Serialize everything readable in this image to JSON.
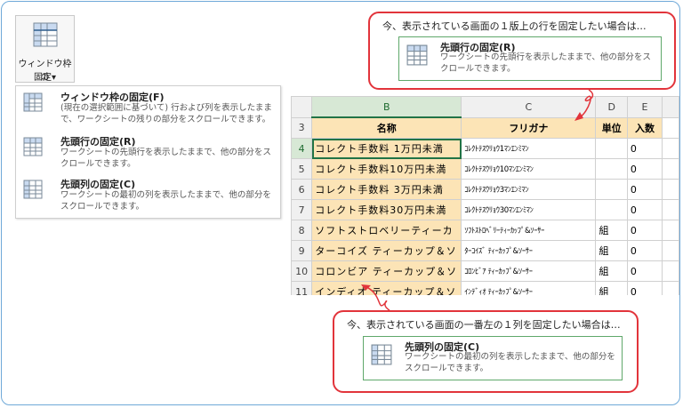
{
  "ribbon": {
    "button_label_line1": "ウィンドウ枠の",
    "button_label_line2": "固定▾",
    "icon": "freeze-panes-icon"
  },
  "menu": {
    "items": [
      {
        "title": "ウィンドウ枠の固定(F)",
        "desc": "(現在の選択範囲に基づいて) 行および列を表示したままで、ワークシートの残りの部分をスクロールできます。",
        "icon": "freeze-panes-icon"
      },
      {
        "title": "先頭行の固定(R)",
        "desc": "ワークシートの先頭行を表示したままで、他の部分をスクロールできます。",
        "icon": "freeze-top-row-icon"
      },
      {
        "title": "先頭列の固定(C)",
        "desc": "ワークシートの最初の列を表示したままで、他の部分をスクロールできます。",
        "icon": "freeze-first-column-icon"
      }
    ]
  },
  "sheet": {
    "columns": [
      "B",
      "C",
      "D",
      "E"
    ],
    "header_row": {
      "num": "3",
      "cells": [
        "名称",
        "フリガナ",
        "単位",
        "入数"
      ]
    },
    "rows": [
      {
        "num": "4",
        "cells": [
          "コレクト手数料 1万円未満",
          "ｺﾚｸﾄﾃｽｳﾘｮｳ1ﾏﾝｴﾝﾐﾏﾝ",
          "",
          "0"
        ]
      },
      {
        "num": "5",
        "cells": [
          "コレクト手数料10万円未満",
          "ｺﾚｸﾄﾃｽｳﾘｮｳ10ﾏﾝｴﾝﾐﾏﾝ",
          "",
          "0"
        ]
      },
      {
        "num": "6",
        "cells": [
          "コレクト手数料 3万円未満",
          "ｺﾚｸﾄﾃｽｳﾘｮｳ3ﾏﾝｴﾝﾐﾏﾝ",
          "",
          "0"
        ]
      },
      {
        "num": "7",
        "cells": [
          "コレクト手数料30万円未満",
          "ｺﾚｸﾄﾃｽｳﾘｮｳ30ﾏﾝｴﾝﾐﾏﾝ",
          "",
          "0"
        ]
      },
      {
        "num": "8",
        "cells": [
          "ソフトストロベリーティーカ",
          "ｿﾌﾄｽﾄﾛﾍﾞﾘｰﾃｨｰｶｯﾌﾟ&ｿｰｻｰ",
          "組",
          "0"
        ]
      },
      {
        "num": "9",
        "cells": [
          "ターコイズ ティーカップ＆ソ",
          "ﾀｰｺｲｽﾞ ﾃｨｰｶｯﾌﾟ&ｿｰｻｰ",
          "組",
          "0"
        ]
      },
      {
        "num": "10",
        "cells": [
          "コロンビア ティーカップ＆ソ",
          "ｺﾛﾝﾋﾞｱ ﾃｨｰｶｯﾌﾟ&ｿｰｻｰ",
          "組",
          "0"
        ]
      },
      {
        "num": "11",
        "cells": [
          "インディオ ティーカップ＆ソ",
          "ｲﾝﾃﾞｨｵ ﾃｨｰｶｯﾌﾟ&ｿｰｻｰ",
          "組",
          "0"
        ]
      }
    ]
  },
  "callout_top": {
    "text": "今、表示されている画面の１版上の行を固定したい場合は…",
    "pane_title": "先頭行の固定(R)",
    "pane_desc": "ワークシートの先頭行を表示したままで、他の部分をスクロールできます。"
  },
  "callout_bottom": {
    "text": "今、表示されている画面の一番左の１列を固定したい場合は…",
    "pane_title": "先頭列の固定(C)",
    "pane_desc": "ワークシートの最初の列を表示したままで、他の部分をスクロールできます。"
  },
  "colors": {
    "frame": "#6fa9d8",
    "callout_border": "#e2343b",
    "header_fill": "#fce4b6",
    "selection": "#217346"
  }
}
